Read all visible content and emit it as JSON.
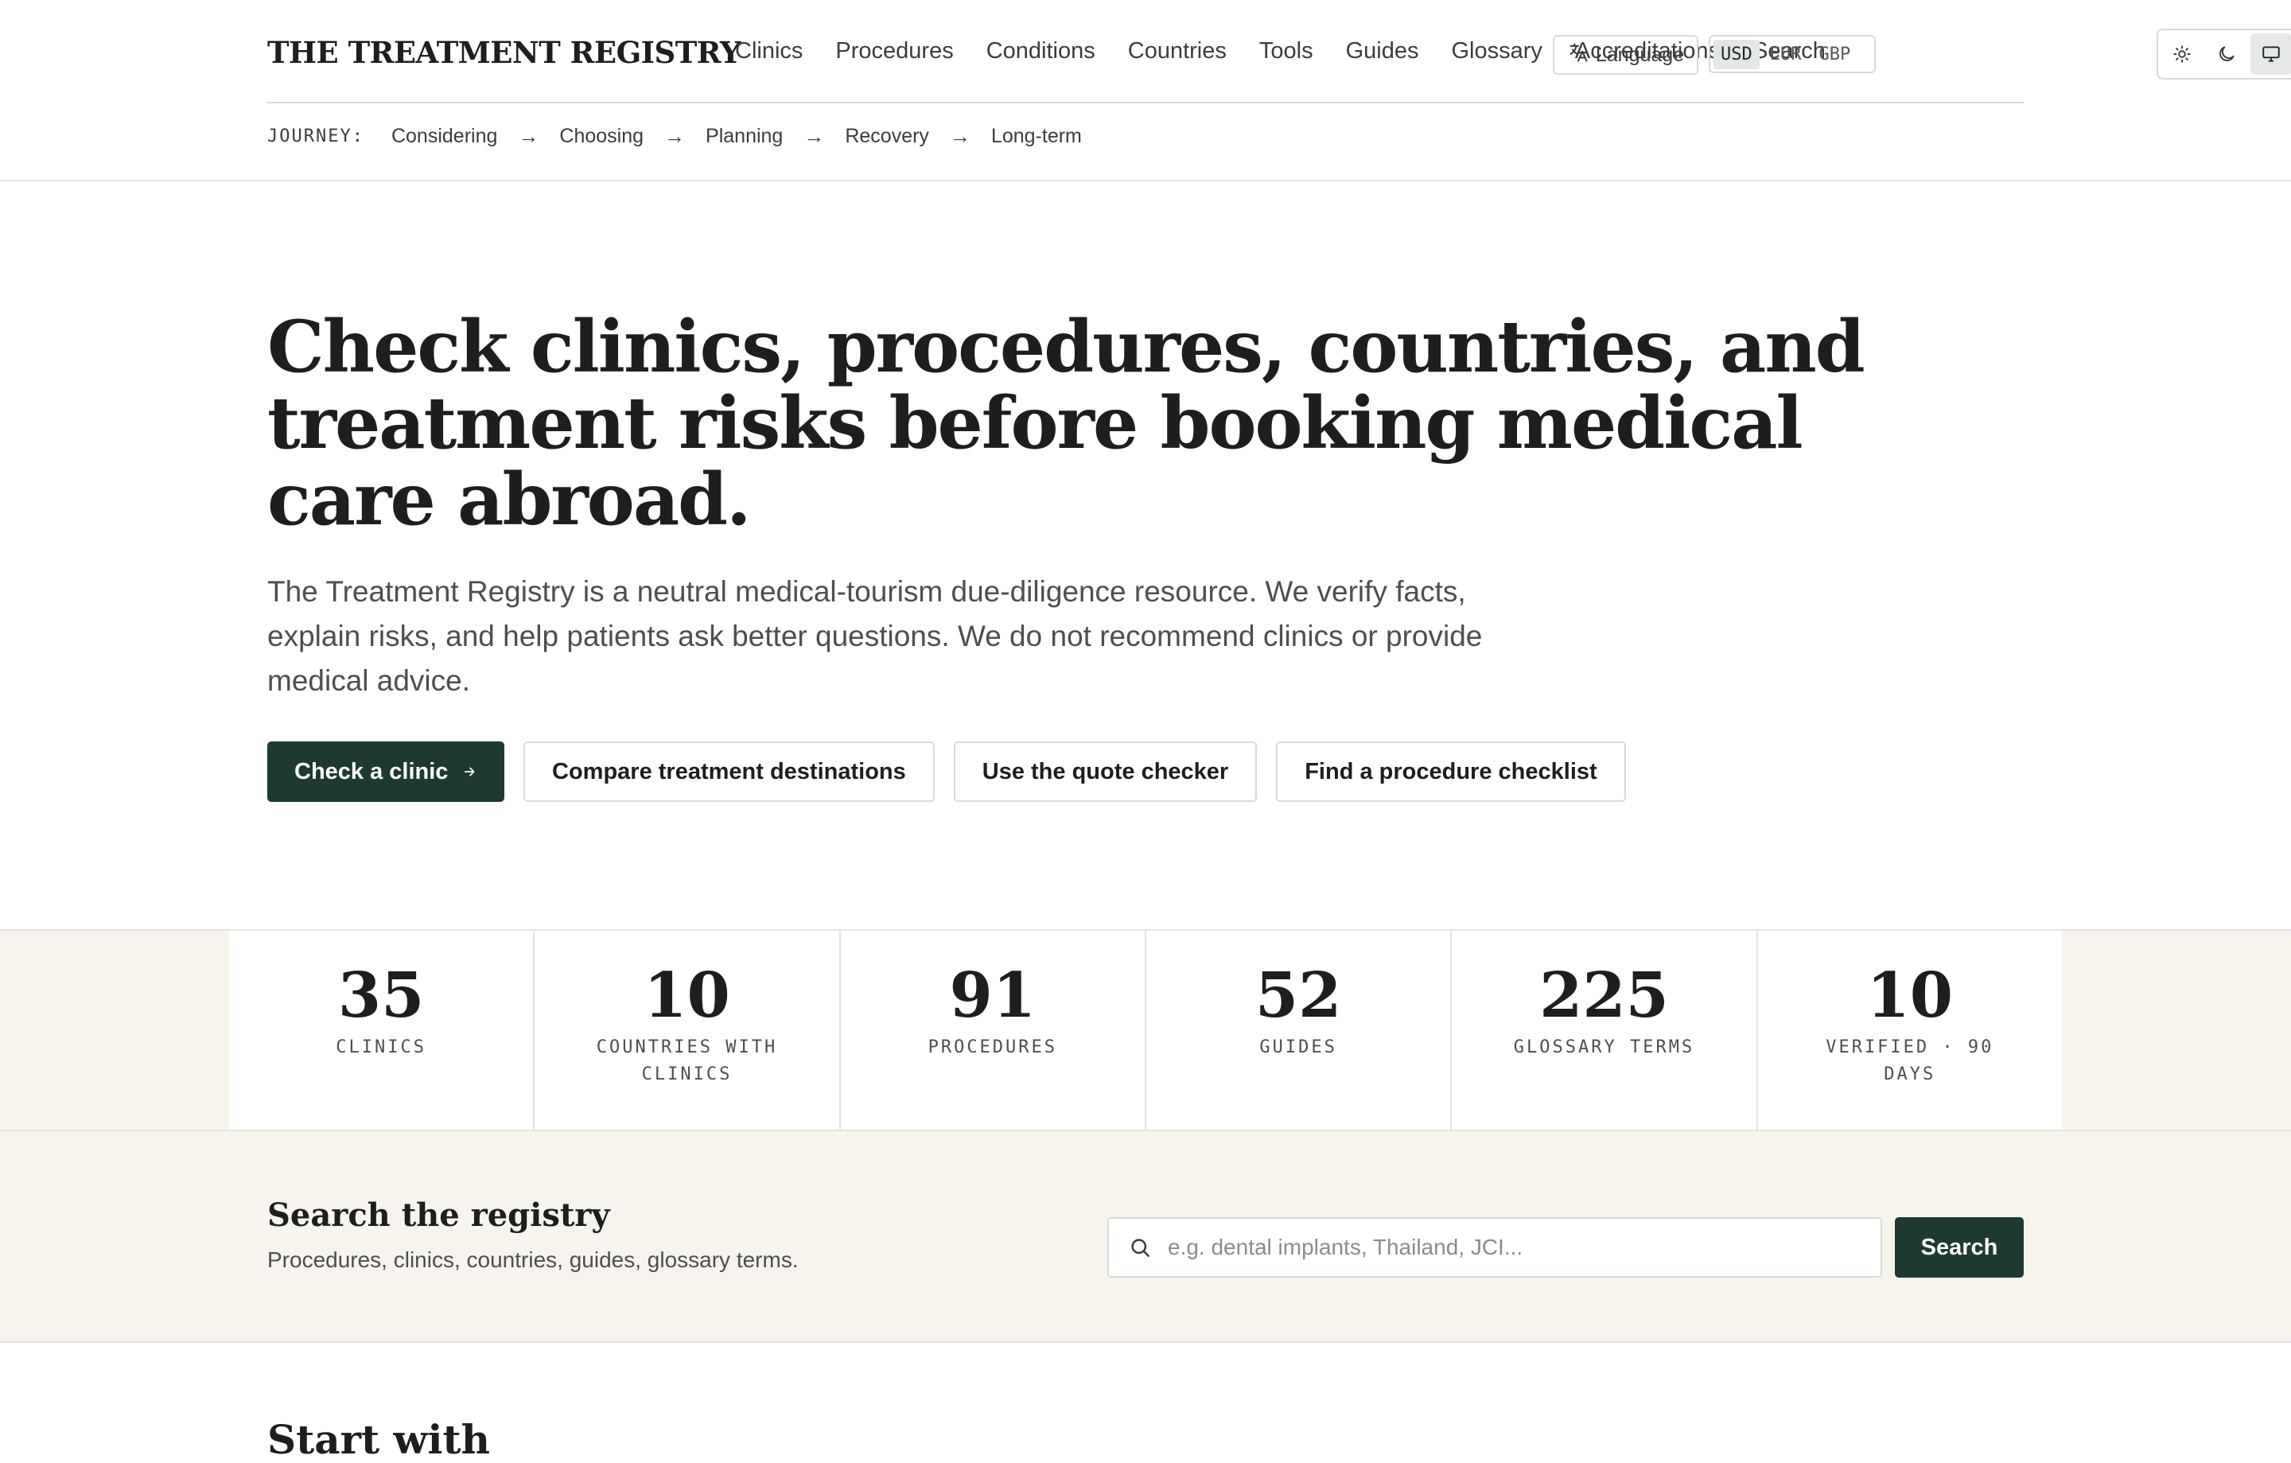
{
  "header": {
    "brand": "THE TREATMENT REGISTRY",
    "nav": [
      "Clinics",
      "Procedures",
      "Conditions",
      "Countries",
      "Tools",
      "Guides",
      "Glossary",
      "Accreditations",
      "Search"
    ],
    "language_label": "Language",
    "currencies": [
      "USD",
      "EUR",
      "GBP"
    ],
    "active_currency": "USD",
    "theme_options": [
      "light-icon",
      "dark-icon",
      "system-icon"
    ],
    "active_theme": "system"
  },
  "journey": {
    "label": "JOURNEY:",
    "steps": [
      "Considering",
      "Choosing",
      "Planning",
      "Recovery",
      "Long-term"
    ],
    "separator": "→"
  },
  "hero": {
    "title": "Check clinics, procedures, countries, and treatment risks before booking medical care abroad.",
    "subtitle": "The Treatment Registry is a neutral medical-tourism due-diligence resource. We verify facts, explain risks, and help patients ask better questions. We do not recommend clinics or provide medical advice.",
    "primary_cta": "Check a clinic",
    "secondary_ctas": [
      "Compare treatment destinations",
      "Use the quote checker",
      "Find a procedure checklist"
    ]
  },
  "stats": [
    {
      "value": "35",
      "label": "CLINICS"
    },
    {
      "value": "10",
      "label": "COUNTRIES WITH CLINICS"
    },
    {
      "value": "91",
      "label": "PROCEDURES"
    },
    {
      "value": "52",
      "label": "GUIDES"
    },
    {
      "value": "225",
      "label": "GLOSSARY TERMS"
    },
    {
      "value": "10",
      "label": "VERIFIED · 90 DAYS"
    }
  ],
  "search": {
    "title": "Search the registry",
    "description": "Procedures, clinics, countries, guides, glossary terms.",
    "placeholder": "e.g. dental implants, Thailand, JCI...",
    "value": "",
    "button_label": "Search"
  },
  "next_section": {
    "title": "Start with"
  },
  "colors": {
    "accent": "#1d3a30",
    "band_background": "#f7f4ee",
    "border": "#e6e3dc"
  }
}
